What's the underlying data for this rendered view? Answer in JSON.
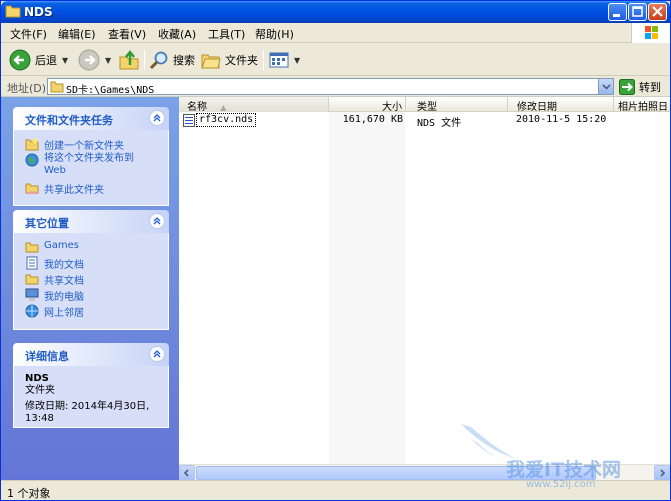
{
  "window": {
    "title": "NDS"
  },
  "menu": [
    "文件(F)",
    "编辑(E)",
    "查看(V)",
    "收藏(A)",
    "工具(T)",
    "帮助(H)"
  ],
  "toolbar": {
    "back": "后退",
    "search": "搜索",
    "folders": "文件夹"
  },
  "address": {
    "label": "地址(D)",
    "value": "SD卡:\\Games\\NDS",
    "go": "转到"
  },
  "tasks_panel": {
    "title": "文件和文件夹任务",
    "items": [
      "创建一个新文件夹",
      "将这个文件夹发布到 Web",
      "共享此文件夹"
    ]
  },
  "places_panel": {
    "title": "其它位置",
    "items": [
      "Games",
      "我的文档",
      "共享文档",
      "我的电脑",
      "网上邻居"
    ]
  },
  "details_panel": {
    "title": "详细信息",
    "name": "NDS",
    "type": "文件夹",
    "modified_label": "修改日期: 2014年4月30日,",
    "modified_time": "13:48"
  },
  "columns": [
    "名称",
    "大小",
    "类型",
    "修改日期",
    "相片拍照日"
  ],
  "files": [
    {
      "name": "rf3cv.nds",
      "size": "161,670 KB",
      "type": "NDS 文件",
      "modified": "2010-11-5 15:20"
    }
  ],
  "status": {
    "text": "1 个对象"
  },
  "watermark": {
    "text": "我爱IT技术网",
    "url": "www.52ij.com"
  },
  "colors": {
    "title_bar": "#0054e3",
    "task_pane": "#7ba2e7",
    "link": "#215dc6"
  }
}
